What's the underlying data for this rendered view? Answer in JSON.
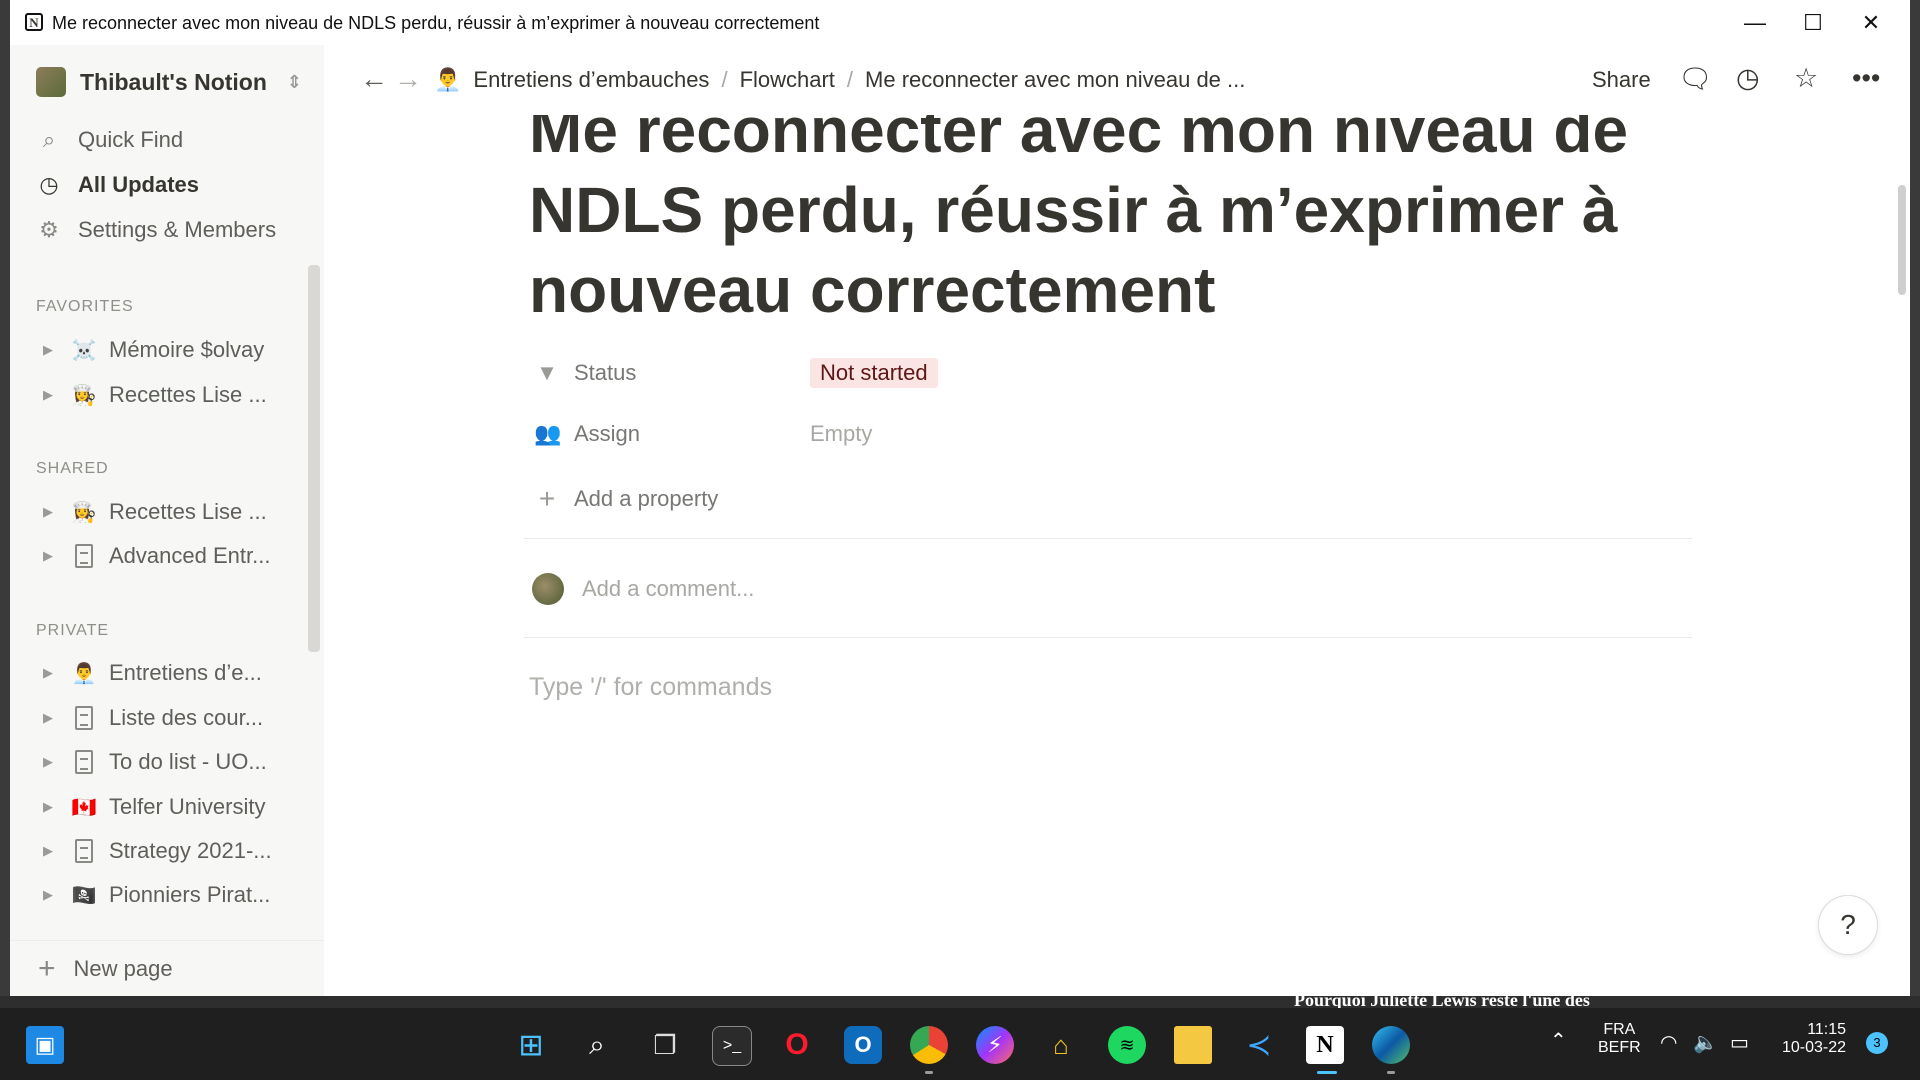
{
  "window": {
    "title": "Me reconnecter avec mon niveau de NDLS perdu, réussir à m’exprimer à nouveau correctement",
    "app_icon_letter": "N"
  },
  "sidebar": {
    "workspace": "Thibault's Notion",
    "nav": [
      {
        "label": "Quick Find",
        "icon": "search-icon"
      },
      {
        "label": "All Updates",
        "icon": "clock-icon"
      },
      {
        "label": "Settings & Members",
        "icon": "gear-icon"
      }
    ],
    "sections": [
      {
        "label": "FAVORITES",
        "items": [
          {
            "label": "Mémoire $olvay",
            "icon": "☠️"
          },
          {
            "label": "Recettes Lise ...",
            "icon": "👩‍🍳"
          }
        ]
      },
      {
        "label": "SHARED",
        "items": [
          {
            "label": "Recettes Lise ...",
            "icon": "👩‍🍳"
          },
          {
            "label": "Advanced Entr...",
            "icon": "page-icon"
          }
        ]
      },
      {
        "label": "PRIVATE",
        "items": [
          {
            "label": "Entretiens d’e...",
            "icon": "👨‍💼"
          },
          {
            "label": "Liste des cour...",
            "icon": "page-icon"
          },
          {
            "label": "To do list - UO...",
            "icon": "page-icon"
          },
          {
            "label": "Telfer University",
            "icon": "🇨🇦"
          },
          {
            "label": "Strategy 2021-...",
            "icon": "page-icon"
          },
          {
            "label": "Pionniers Pirat...",
            "icon": "🏴‍☠️"
          }
        ]
      }
    ],
    "new_page": "New page"
  },
  "topbar": {
    "breadcrumb": [
      "Entretiens d’embauches",
      "Flowchart",
      "Me reconnecter avec mon niveau de ..."
    ],
    "breadcrumb_icon": "👨‍💼",
    "separator": "/",
    "share": "Share"
  },
  "page": {
    "title": "Me reconnecter avec mon niveau de NDLS perdu, réussir à m’exprimer à nouveau correctement",
    "properties": [
      {
        "name": "Status",
        "value": "Not started",
        "icon": "status-icon"
      },
      {
        "name": "Assign",
        "value": "Empty",
        "icon": "person-icon"
      }
    ],
    "add_property": "Add a property",
    "comment_placeholder": "Add a comment...",
    "command_hint": "Type '/' for commands",
    "help": "?"
  },
  "background_text": "Pourquoi Juliette Lewis reste l'une des",
  "taskbar": {
    "tray": {
      "lang": "FRA",
      "layout": "BEFR",
      "time": "11:15",
      "date": "10-03-22",
      "notifications": "3"
    }
  },
  "colors": {
    "status_bg": "#fbe4e4",
    "status_text": "#5d1715",
    "sidebar_bg": "#f7f7f5",
    "taskbar_bg": "#1f1f1f"
  }
}
